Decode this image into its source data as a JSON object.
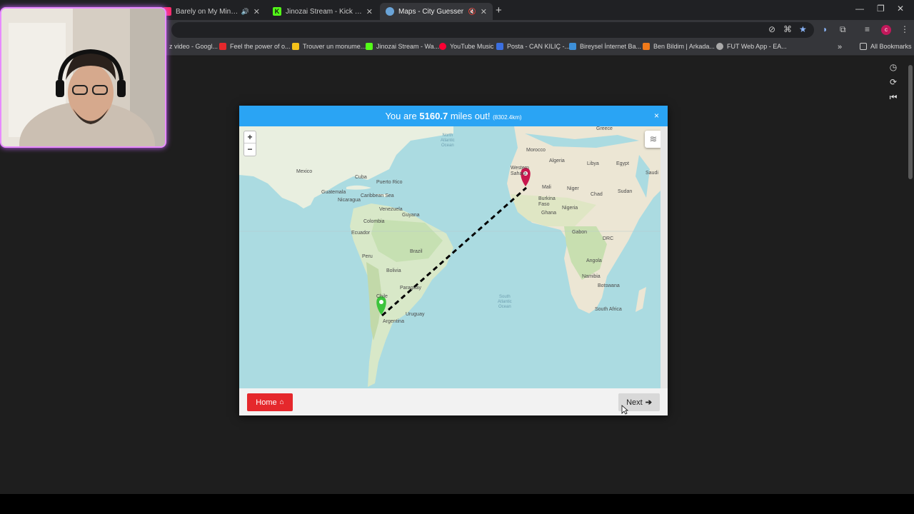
{
  "tabs": [
    {
      "title": "",
      "favicon_color": "#2fd13b"
    },
    {
      "title": "Barely on My Mind | YouTube",
      "favicon_color": "#ff2a6a",
      "muted_icon": "speaker-icon"
    },
    {
      "title": "Jinozai Stream - Kick Dashboard",
      "favicon_color": "#53fc18"
    },
    {
      "title": "Maps - City Guesser",
      "favicon_color": "#6aa4d8",
      "active": true,
      "muted_icon": "mute-icon"
    }
  ],
  "bookmarks": [
    {
      "label": "z video - Googl...",
      "color": "#ffffff"
    },
    {
      "label": "Feel the power of o...",
      "color": "#e5282c"
    },
    {
      "label": "Trouver un monume...",
      "color": "#f4c21a"
    },
    {
      "label": "Jinozai Stream - Wa...",
      "color": "#53fc18"
    },
    {
      "label": "YouTube Music",
      "color": "#ff0033"
    },
    {
      "label": "Posta - CAN KILIÇ -...",
      "color": "#3b6fe0"
    },
    {
      "label": "Bireysel İnternet Ba...",
      "color": "#3d8fd8"
    },
    {
      "label": "Ben Bildim | Arkada...",
      "color": "#f07a1a"
    },
    {
      "label": "FUT Web App - EA...",
      "color": "#aaaaaa"
    }
  ],
  "all_bookmarks": "All Bookmarks",
  "result": {
    "prefix": "You are",
    "distance_miles": "5160.7",
    "suffix": "miles out!",
    "distance_km": "(8302.4km)"
  },
  "map": {
    "zoom_in": "+",
    "zoom_out": "−",
    "labels": {
      "greece": "Greece",
      "morocco": "Morocco",
      "algeria": "Algeria",
      "libya": "Libya",
      "egypt": "Egypt",
      "saudi": "Saudi",
      "western_sahara": "Western\nSahara",
      "mali": "Mali",
      "niger": "Niger",
      "chad": "Chad",
      "sudan": "Sudan",
      "burkina": "Burkina\nFaso",
      "ghana": "Ghana",
      "nigeria": "Nigeria",
      "gabon": "Gabon",
      "drc": "DRC",
      "angola": "Angola",
      "namibia": "Namibia",
      "botswana": "Botswana",
      "south_africa": "South Africa",
      "mexico": "Mexico",
      "cuba": "Cuba",
      "puerto_rico": "Puerto Rico",
      "guatemala": "Guatemala",
      "nicaragua": "Nicaragua",
      "venezuela": "Venezuela",
      "guyana": "Guyana",
      "colombia": "Colombia",
      "ecuador": "Ecuador",
      "peru": "Peru",
      "brazil": "Brazil",
      "bolivia": "Bolivia",
      "paraguay": "Paraguay",
      "chile": "Chile",
      "uruguay": "Uruguay",
      "argentina": "Argentina",
      "north_atlantic": "North\nAtlantic\nOcean",
      "south_atlantic": "South\nAtlantic\nOcean",
      "caribbean": "Caribbean Sea"
    }
  },
  "buttons": {
    "home": "Home",
    "next": "Next"
  },
  "close_symbol": "×"
}
